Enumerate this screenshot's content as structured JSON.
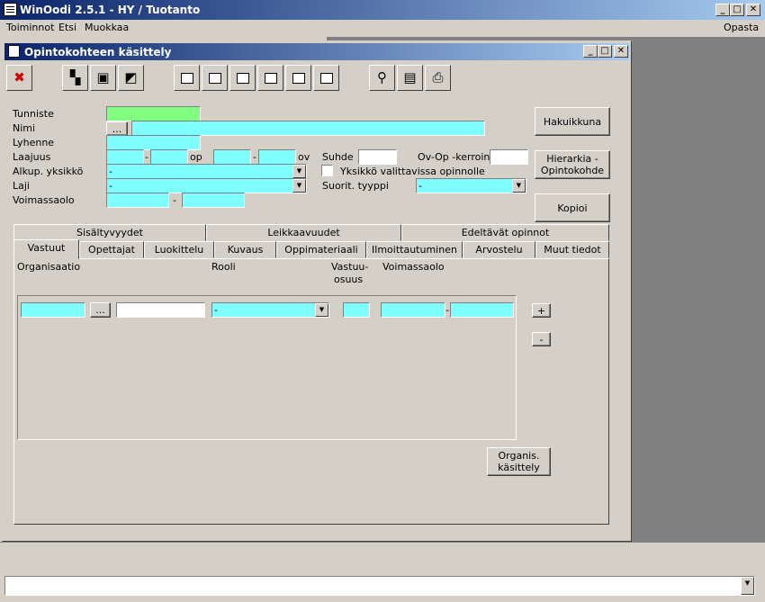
{
  "app": {
    "title": "WinOodi 2.5.1  -  HY / Tuotanto"
  },
  "window_controls": {
    "minimize": "_",
    "maximize": "□",
    "close": "✕"
  },
  "menu": {
    "items": [
      "Toiminnot",
      "Etsi",
      "Muokkaa"
    ],
    "help": "Opasta"
  },
  "child": {
    "title": "Opintokohteen käsittely",
    "toolbar_icons": [
      "close-icon",
      "layers-icon",
      "save-icon",
      "export-icon",
      "add-record-icon",
      "delete-record-icon",
      "first-record-icon",
      "previous-record-icon",
      "next-record-icon",
      "last-record-icon",
      "search-icon",
      "document-icon",
      "print-icon"
    ]
  },
  "form": {
    "tunniste_label": "Tunniste",
    "tunniste_value": "",
    "nimi_label": "Nimi",
    "browse": "...",
    "lyhenne_label": "Lyhenne",
    "laajuus_label": "Laajuus",
    "dash": "-",
    "op": "op",
    "ov": "ov",
    "suhde_label": "Suhde",
    "ovop_label": "Ov-Op -kerroin",
    "alkup_label": "Alkup. yksikkö",
    "alkup_value": "-",
    "yksikko_check_label": "Yksikkö valittavissa opinnolle",
    "laji_label": "Laji",
    "laji_value": "-",
    "suorit_label": "Suorit. tyyppi",
    "suorit_value": "-",
    "voimassaolo_label": "Voimassaolo"
  },
  "buttons": {
    "hakuikkuna": "Hakuikkuna",
    "hierarkia": "Hierarkia -\nOpintokohde",
    "kopioi": "Kopioi",
    "organis": "Organis.\nkäsittely",
    "plus": "+",
    "minus": "-"
  },
  "tabs_row1": [
    "Sisältyvyydet",
    "Leikkaavuudet",
    "Edeltävät opinnot"
  ],
  "tabs_row2": [
    "Vastuut",
    "Opettajat",
    "Luokittelu",
    "Kuvaus",
    "Oppimateriaali",
    "Ilmoittautuminen",
    "Arvostelu",
    "Muut tiedot"
  ],
  "vastuut": {
    "headers": {
      "organisaatio": "Organisaatio",
      "rooli": "Rooli",
      "vastuu_l1": "Vastuu-",
      "vastuu_l2": "osuus",
      "voimassaolo": "Voimassaolo"
    },
    "row": {
      "browse": "...",
      "rooli_value": "-",
      "dash": "-"
    }
  },
  "bottom": {
    "combo_value": ""
  }
}
